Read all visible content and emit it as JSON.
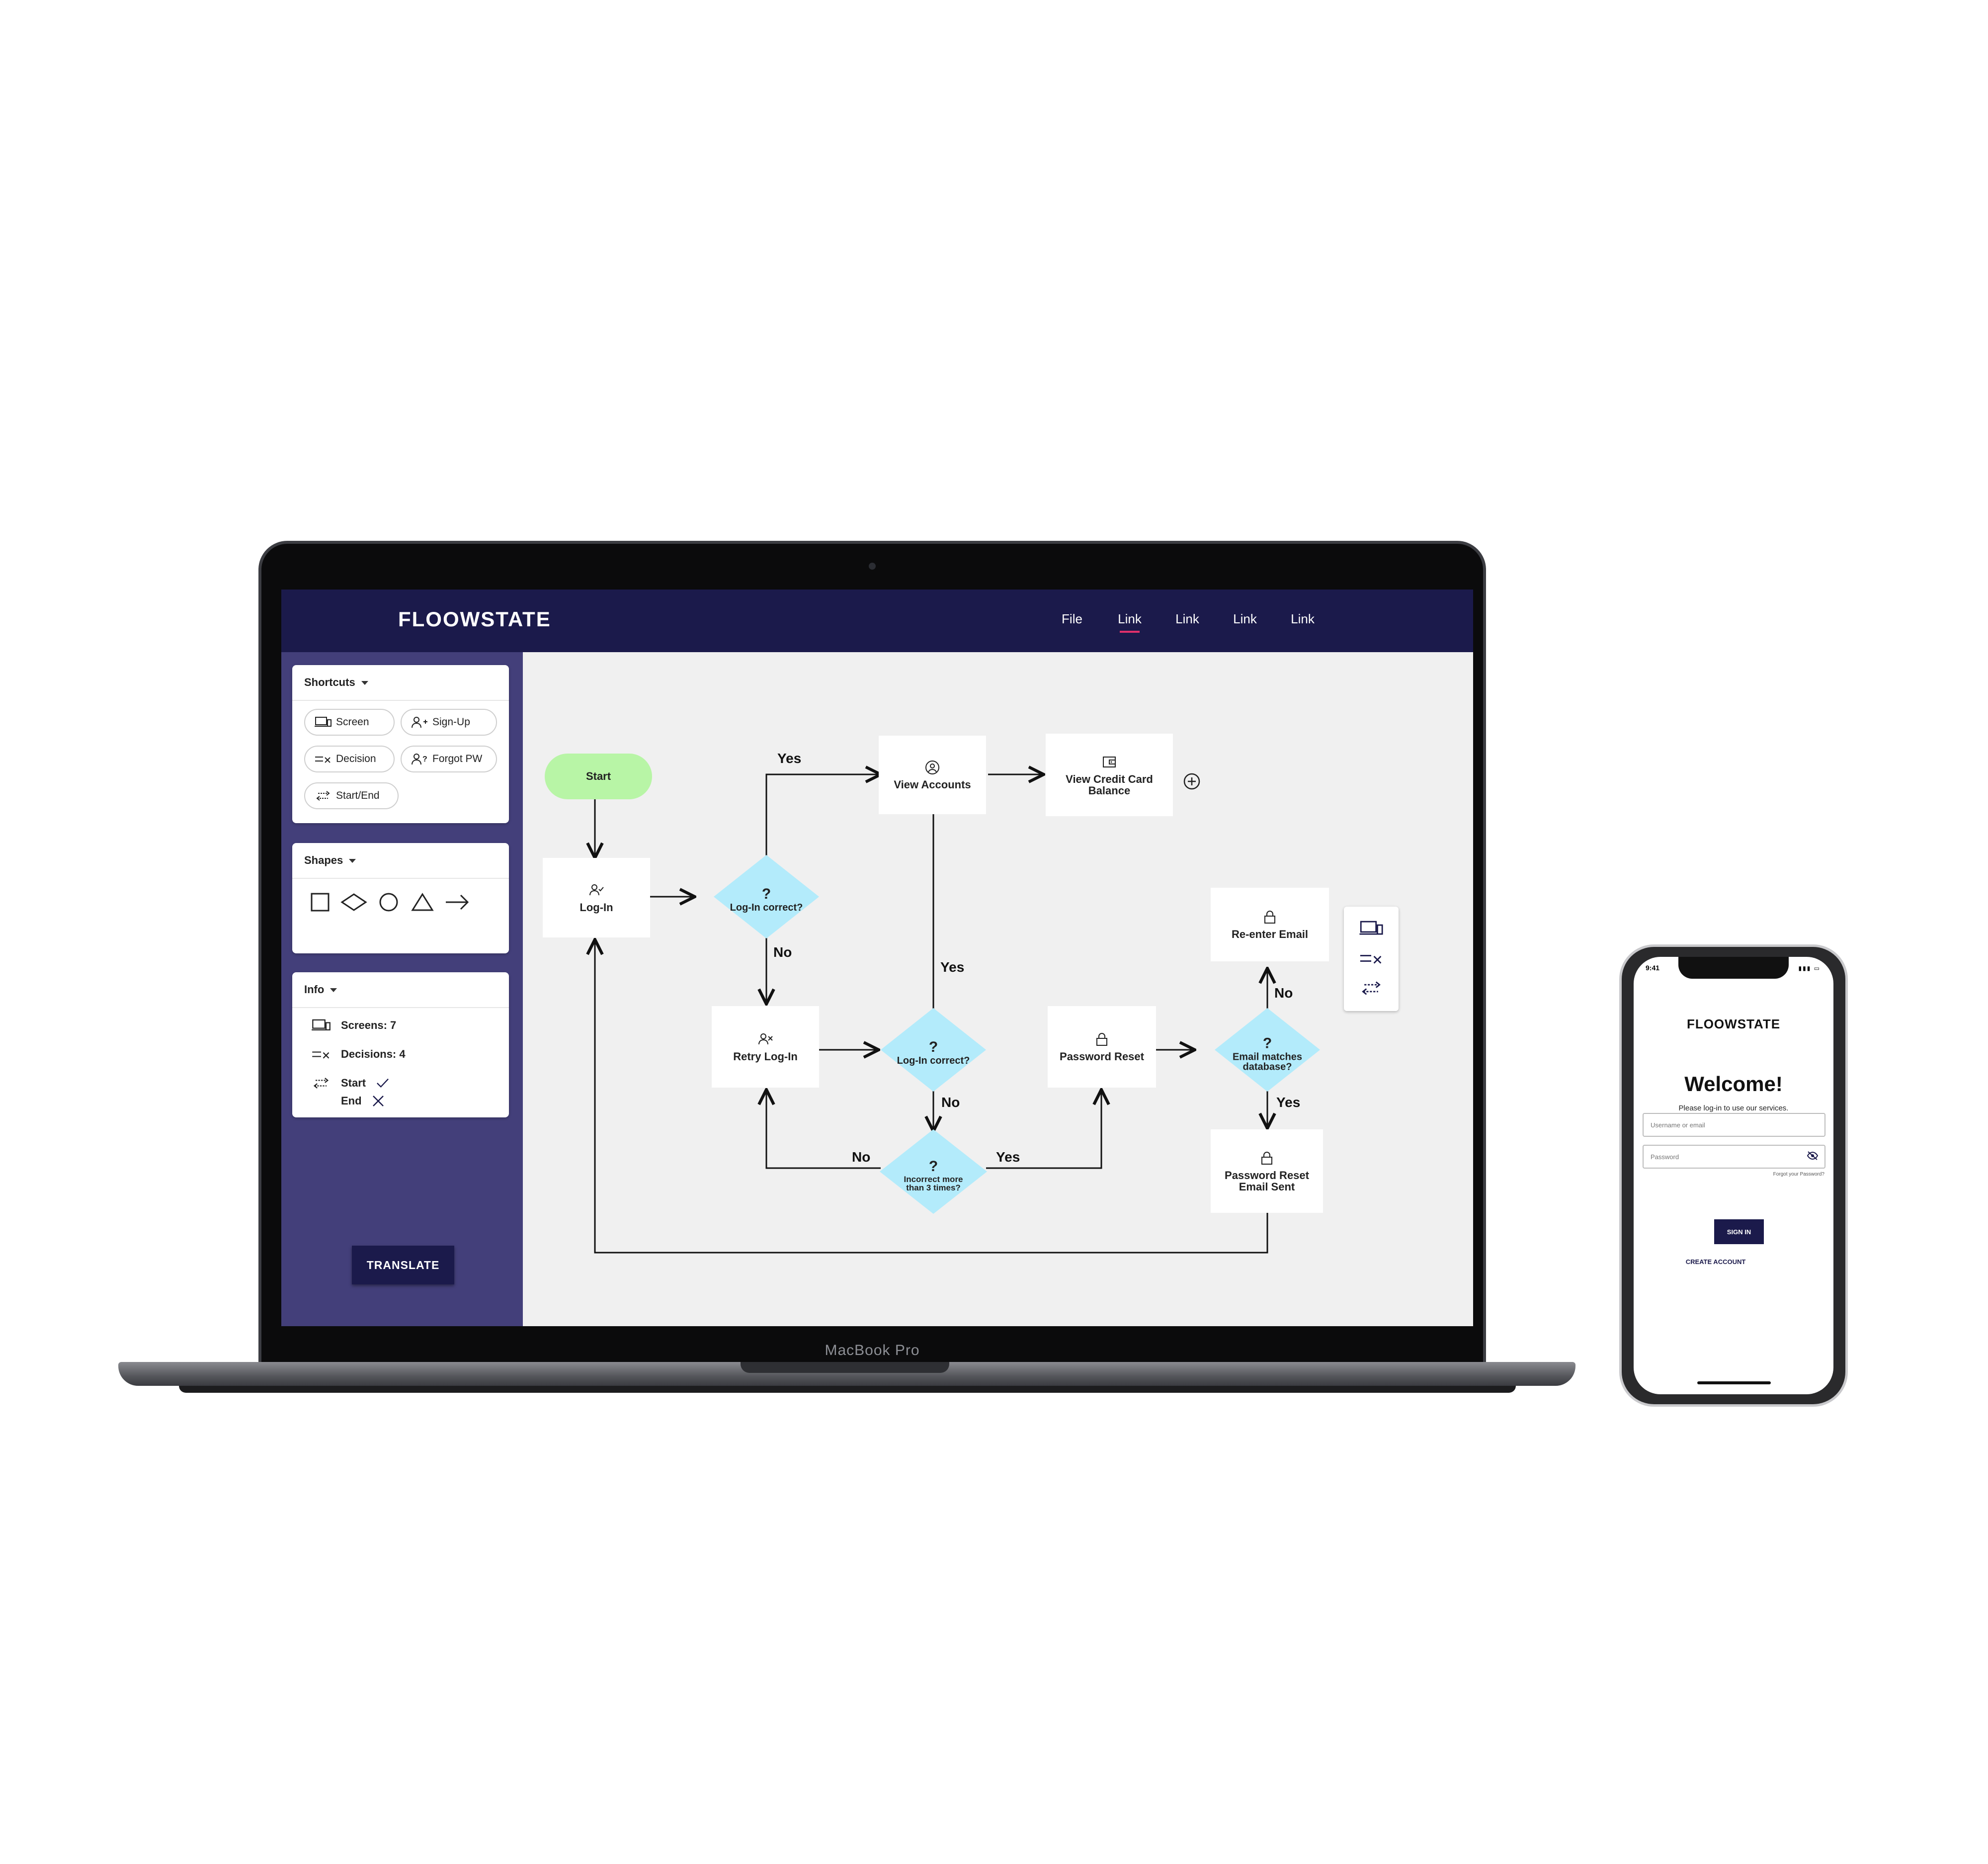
{
  "laptop": {
    "brand_label": "MacBook Pro"
  },
  "header": {
    "logo": "FLOOWSTATE",
    "nav": [
      "File",
      "Link",
      "Link",
      "Link",
      "Link"
    ],
    "active_nav_index": 1
  },
  "sidebar": {
    "shortcuts": {
      "title": "Shortcuts",
      "items": [
        {
          "label": "Screen",
          "icon": "screen-icon"
        },
        {
          "label": "Sign-Up",
          "icon": "user-plus-icon"
        },
        {
          "label": "Decision",
          "icon": "decision-icon"
        },
        {
          "label": "Forgot PW",
          "icon": "user-question-icon"
        },
        {
          "label": "Start/End",
          "icon": "start-end-icon"
        }
      ]
    },
    "shapes": {
      "title": "Shapes",
      "items": [
        "square-shape-icon",
        "diamond-shape-icon",
        "circle-shape-icon",
        "triangle-shape-icon",
        "arrow-shape-icon"
      ]
    },
    "info": {
      "title": "Info",
      "screens": "Screens: 7",
      "decisions": "Decisions: 4",
      "start": "Start",
      "end": "End"
    },
    "translate_label": "TRANSLATE"
  },
  "flowchart": {
    "nodes": {
      "start": "Start",
      "login": "Log-In",
      "view_accounts": "View Accounts",
      "view_credit_card": "View Credit Card Balance",
      "retry_login": "Retry Log-In",
      "password_reset": "Password Reset",
      "reenter_email": "Re-enter Email",
      "password_reset_sent": "Password Reset Email Sent"
    },
    "decisions": {
      "login_correct_1": "Log-In correct?",
      "login_correct_2": "Log-In correct?",
      "incorrect_more": "Incorrect more than 3 times?",
      "email_matches": "Email matches database?"
    },
    "decision_mark": "?",
    "labels": {
      "yes": "Yes",
      "no": "No"
    }
  },
  "phone": {
    "time": "9:41",
    "logo": "FLOOWSTATE",
    "welcome": "Welcome!",
    "subtitle": "Please log-in to use our services.",
    "username_placeholder": "Username or email",
    "password_placeholder": "Password",
    "forgot": "Forgot your Password?",
    "sign_in": "SIGN IN",
    "create_account": "CREATE ACCOUNT"
  },
  "colors": {
    "header_navy": "#1b1a4b",
    "sidebar_purple": "#433f7a",
    "start_green": "#b8f5a6",
    "decision_blue": "#b3ebfb",
    "nav_active_underline": "#e0306b"
  }
}
